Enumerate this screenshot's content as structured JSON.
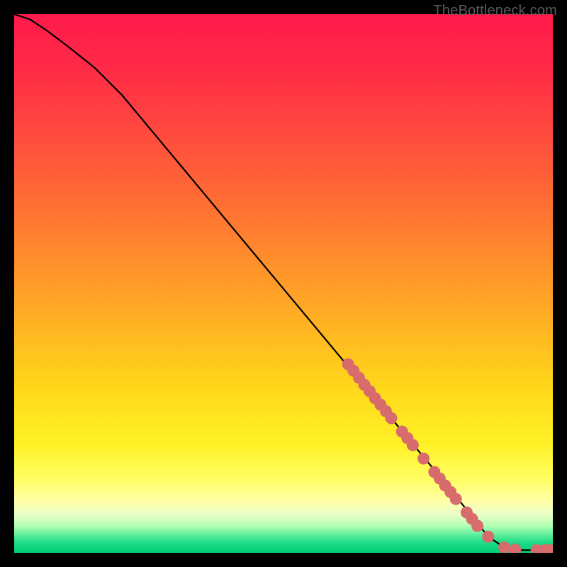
{
  "watermark": "TheBottleneck.com",
  "chart_data": {
    "type": "line",
    "title": "",
    "xlabel": "",
    "ylabel": "",
    "xlim": [
      0,
      100
    ],
    "ylim": [
      0,
      100
    ],
    "grid": false,
    "legend": "none",
    "series": [
      {
        "name": "bottleneck-curve",
        "x": [
          0,
          3,
          6,
          10,
          15,
          20,
          30,
          40,
          50,
          60,
          70,
          80,
          88,
          91,
          94,
          97,
          100
        ],
        "y": [
          100,
          99,
          97,
          94,
          90,
          85,
          73,
          61,
          49,
          37,
          25,
          13,
          3,
          1,
          0.5,
          0.5,
          0.5
        ]
      }
    ],
    "markers": {
      "name": "data-points",
      "color": "#d86b6b",
      "x": [
        62,
        63,
        64,
        65,
        66,
        67,
        68,
        69,
        70,
        72,
        73,
        74,
        76,
        78,
        79,
        80,
        81,
        82,
        84,
        85,
        86,
        88,
        91,
        93,
        97,
        98.5,
        99.5
      ],
      "y": [
        35,
        33.8,
        32.5,
        31.2,
        30,
        28.7,
        27.5,
        26.3,
        25,
        22.5,
        21.3,
        20,
        17.5,
        15,
        13.8,
        12.5,
        11.3,
        10,
        7.5,
        6.3,
        5,
        3,
        1,
        0.6,
        0.5,
        0.5,
        0.5
      ]
    }
  }
}
